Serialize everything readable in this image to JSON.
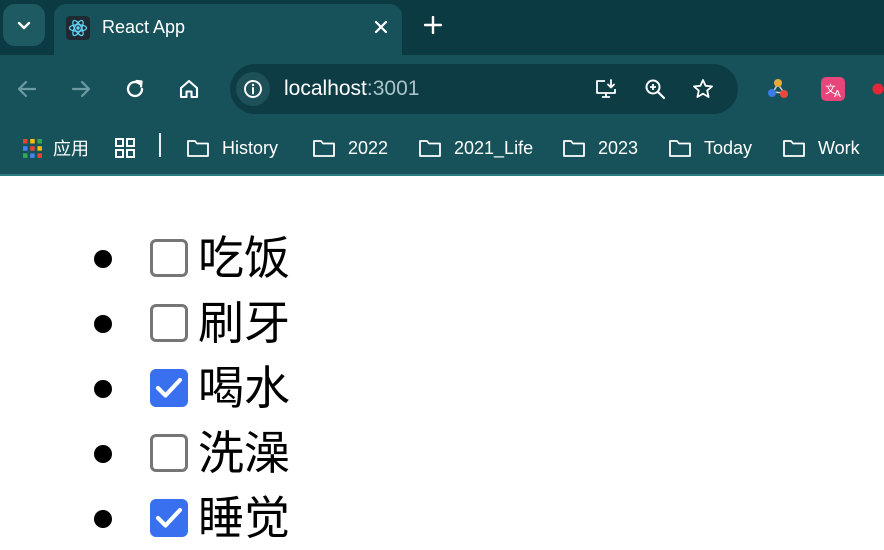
{
  "browser": {
    "tab": {
      "title": "React App",
      "favicon": "react-logo-icon"
    },
    "toolbar": {
      "url_host": "localhost",
      "url_port": ":3001"
    },
    "bookmarks": {
      "apps_label": "应用",
      "folders": [
        "History",
        "2022",
        "2021_Life",
        "2023",
        "Today",
        "Work"
      ]
    }
  },
  "todos": [
    {
      "text": "吃饭",
      "done": false
    },
    {
      "text": "刷牙",
      "done": false
    },
    {
      "text": "喝水",
      "done": true
    },
    {
      "text": "洗澡",
      "done": false
    },
    {
      "text": "睡觉",
      "done": true
    }
  ],
  "colors": {
    "tabstrip": "#0b3a42",
    "toolbar": "#17525b",
    "checkbox_checked": "#3870f0"
  }
}
